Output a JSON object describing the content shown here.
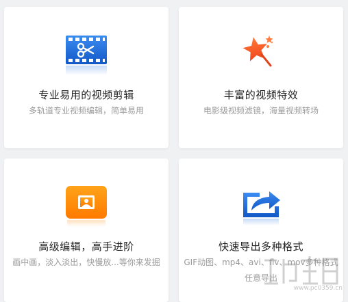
{
  "features": [
    {
      "title": "专业易用的视频剪辑",
      "desc": "多轨道专业视频编辑，简单易用",
      "icon": "video-scissors-icon",
      "icon_color": "#1a6fe0"
    },
    {
      "title": "丰富的视频特效",
      "desc": "电影级视频滤镜，海量视频转场",
      "icon": "star-wand-icon",
      "icon_color": "#ff5a1f"
    },
    {
      "title": "高级编辑，高手进阶",
      "desc": "画中画，淡入淡出，快慢放...等你来发掘",
      "icon": "picture-in-picture-icon",
      "icon_color": "#ff8a00"
    },
    {
      "title": "快速导出多种格式",
      "desc": "GIF动图、mp4、avi、flv、mov多种格式任意导出",
      "icon": "export-share-icon",
      "icon_color": "#1a6fe0"
    }
  ],
  "watermark": {
    "text": "www.pc0359.cn"
  }
}
